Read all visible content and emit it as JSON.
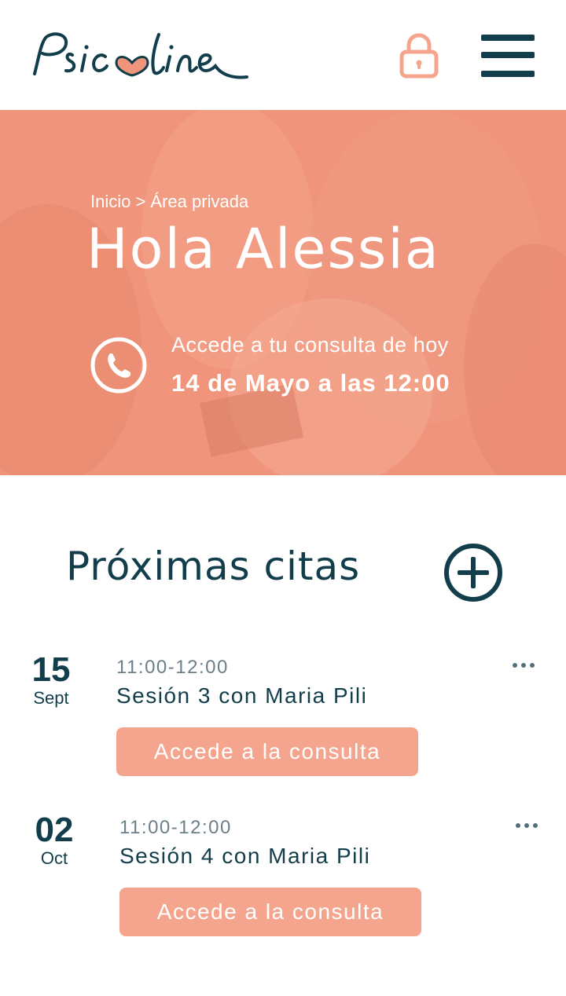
{
  "header": {
    "logo_text": "Psicoline",
    "lock_icon": "lock-icon",
    "menu_icon": "hamburger-menu-icon"
  },
  "hero": {
    "breadcrumb": "Inicio > Área privada",
    "greeting": "Hola Alessia",
    "consult_label": "Accede a tu consulta de hoy",
    "consult_datetime": "14 de Mayo a las 12:00",
    "phone_icon": "phone-icon"
  },
  "appointments_section": {
    "title": "Próximas citas",
    "add_icon": "plus-circle-icon",
    "items": [
      {
        "day": "15",
        "month": "Sept",
        "time": "11:00-12:00",
        "title": "Sesión 3 con Maria Pili",
        "button_label": "Accede a la consulta"
      },
      {
        "day": "02",
        "month": "Oct",
        "time": "11:00-12:00",
        "title": "Sesión 4 con Maria Pili",
        "button_label": "Accede a la consulta"
      }
    ]
  },
  "colors": {
    "brand_dark": "#123e4b",
    "accent_salmon": "#f0957c",
    "button_salmon": "#f5a58e"
  }
}
